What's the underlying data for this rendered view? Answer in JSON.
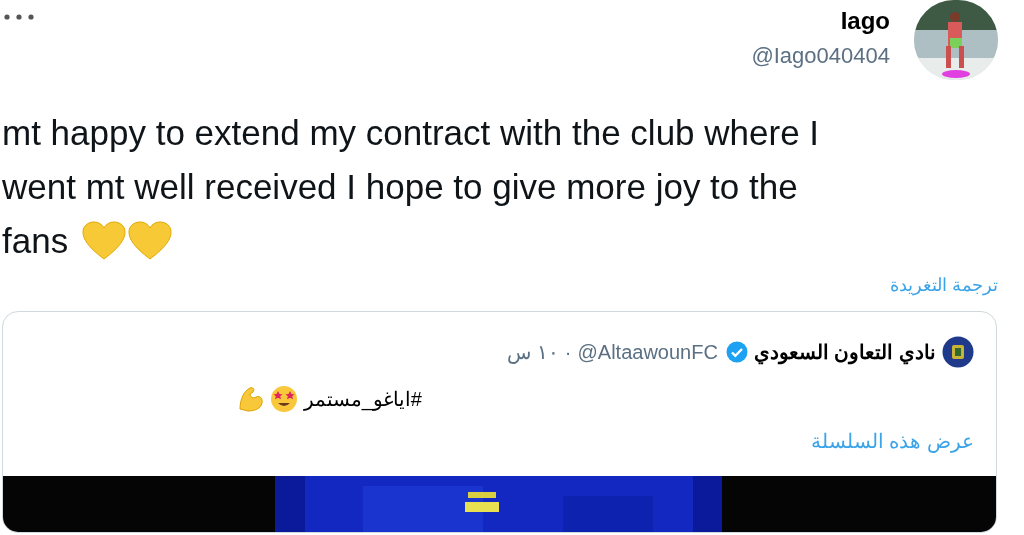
{
  "tweet": {
    "author": {
      "name": "Iago",
      "handle": "@Iago040404"
    },
    "text_lines": [
      "mt happy to extend my contract with the club where I",
      "went mt well received I hope to give more joy to the",
      "fans"
    ],
    "translate_link": "ترجمة التغريدة",
    "quoted": {
      "author": {
        "name": "نادي التعاون السعودي",
        "handle": "@AltaawounFC",
        "verified": true
      },
      "separator": "·",
      "time": "١٠ س",
      "text": "#اياغو_مستمر",
      "show_thread": "عرض هذه السلسلة"
    }
  }
}
